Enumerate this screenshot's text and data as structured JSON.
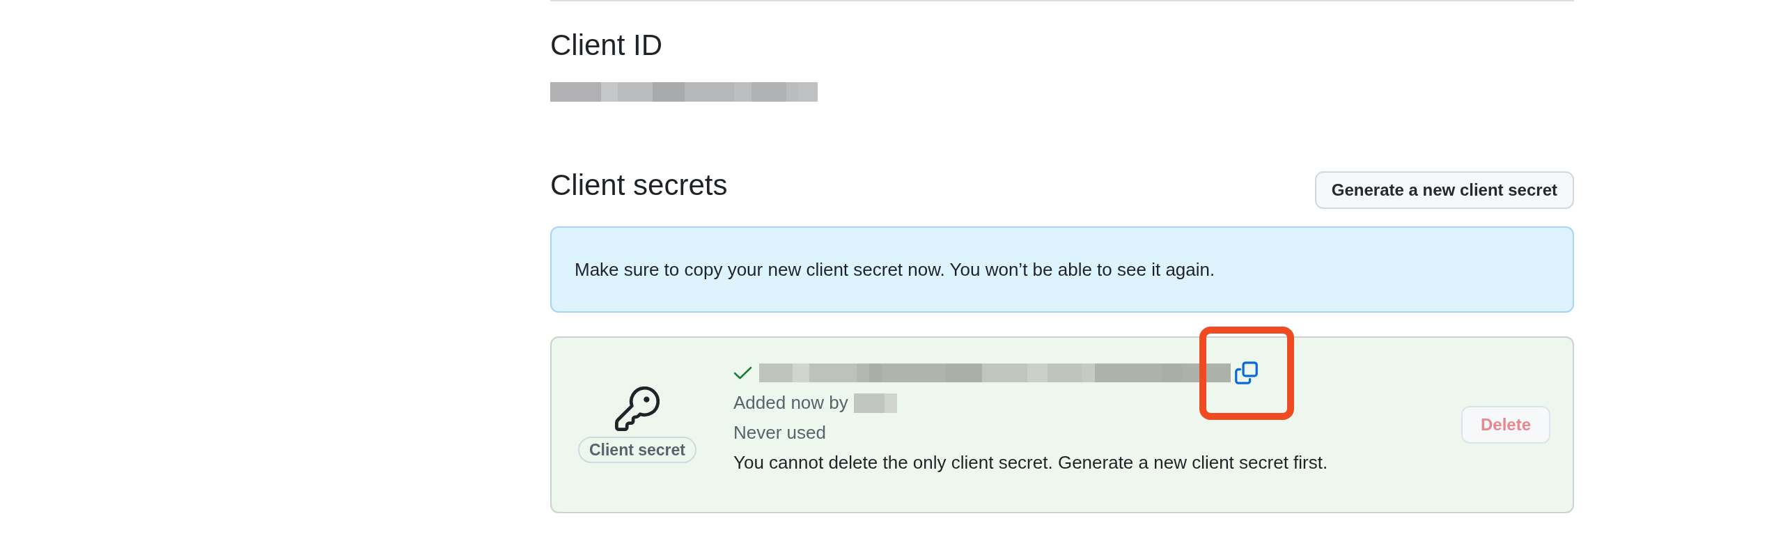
{
  "client_id": {
    "heading": "Client ID"
  },
  "client_secrets": {
    "heading": "Client secrets",
    "generate_button": {
      "label": "Generate a new client secret"
    },
    "notice": "Make sure to copy your new client secret now. You won’t be able to see it again.",
    "secrets": [
      {
        "badge": "Client secret",
        "verified": true,
        "copy_highlighted": true,
        "added": "Added now by",
        "usage": "Never used",
        "warning": "You cannot delete the only client secret. Generate a new client secret first.",
        "delete_button": {
          "label": "Delete",
          "disabled": true
        }
      }
    ]
  }
}
